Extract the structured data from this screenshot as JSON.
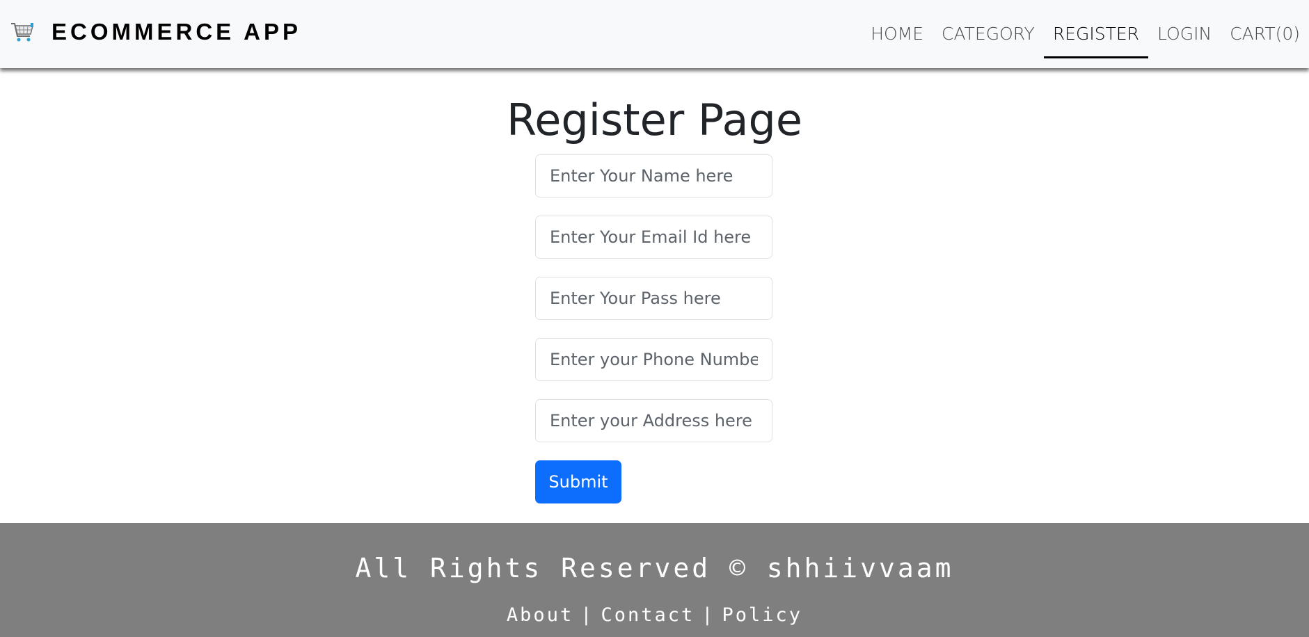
{
  "navbar": {
    "brand_icon": "shopping-cart-icon",
    "brand_text": "ECOMMERCE APP",
    "links": [
      {
        "label": "HOME"
      },
      {
        "label": "CATEGORY"
      },
      {
        "label": "REGISTER",
        "active": true
      },
      {
        "label": "LOGIN"
      },
      {
        "label": "CART(0)"
      }
    ]
  },
  "main": {
    "title": "Register Page",
    "fields": {
      "name": {
        "placeholder": "Enter Your Name here",
        "value": ""
      },
      "email": {
        "placeholder": "Enter Your Email Id here",
        "value": ""
      },
      "password": {
        "placeholder": "Enter Your Pass here",
        "value": ""
      },
      "phone": {
        "placeholder": "Enter your Phone Number",
        "value": ""
      },
      "address": {
        "placeholder": "Enter your Address here",
        "value": ""
      }
    },
    "submit_label": "Submit"
  },
  "footer": {
    "copyright": "All Rights Reserved © shhiivvaam",
    "links": [
      {
        "label": "About"
      },
      {
        "label": "Contact"
      },
      {
        "label": "Policy"
      }
    ],
    "separator": "|"
  },
  "colors": {
    "navbar_bg": "#f8f9fa",
    "primary": "#0d6efd",
    "footer_bg": "#7f7f7f"
  }
}
